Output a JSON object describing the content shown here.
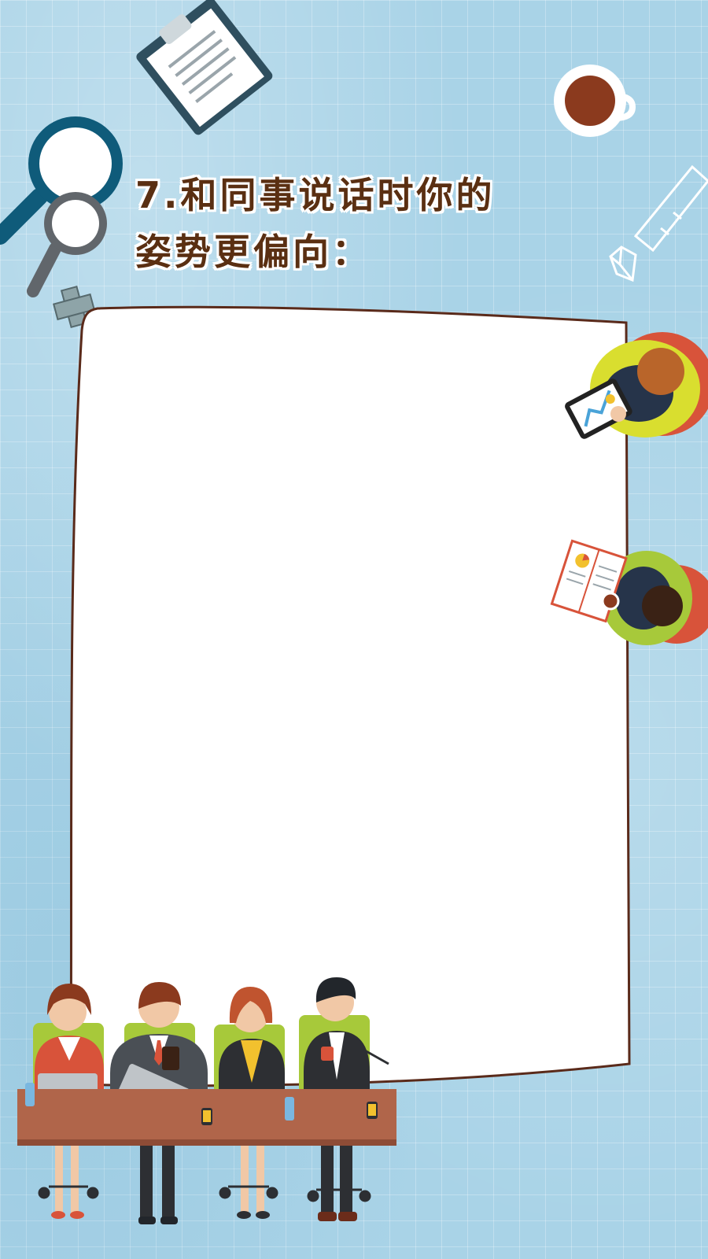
{
  "question": {
    "line1": "7.和同事说话时你的",
    "line2": "姿势更偏向："
  },
  "colors": {
    "background": "#a9d3e7",
    "title_text": "#5a2f12",
    "card_border": "#5a2a1a",
    "table": "#b0654a",
    "chair": "#a7c93a"
  }
}
